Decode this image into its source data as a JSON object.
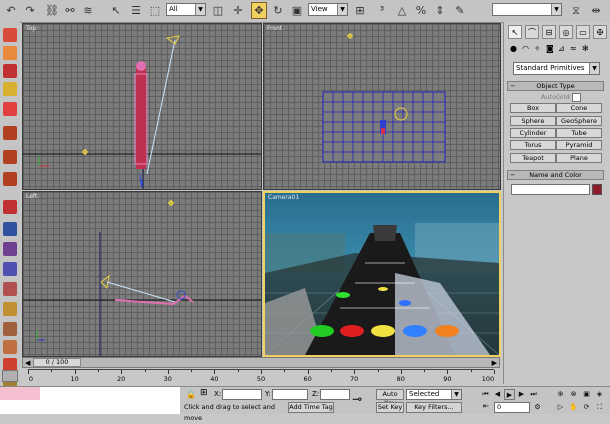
{
  "toolbar": {
    "selection_filter": "All",
    "reference_coord": "View"
  },
  "viewports": {
    "top": "Top",
    "front": "Front",
    "left": "Left",
    "camera": "Camera01"
  },
  "command_panel": {
    "category": "Standard Primitives",
    "object_type_title": "Object Type",
    "autogrid_label": "AutoGrid",
    "buttons": [
      "Box",
      "Cone",
      "Sphere",
      "GeoSphere",
      "Cylinder",
      "Tube",
      "Torus",
      "Pyramid",
      "Teapot",
      "Plane"
    ],
    "name_color_title": "Name and Color",
    "object_color": "#8b1a2a"
  },
  "timeline": {
    "frame_display": "0 / 100",
    "ticks": [
      "0",
      "10",
      "20",
      "30",
      "40",
      "50",
      "60",
      "70",
      "80",
      "90",
      "100"
    ]
  },
  "status": {
    "prompt": "Click and drag to select and move",
    "add_time_tag": "Add Time Tag",
    "x_label": "X:",
    "y_label": "Y:",
    "z_label": "Z:",
    "auto_key": "Auto Key",
    "set_key": "Set Key",
    "key_mode": "Selected",
    "key_filters": "Key Filters...",
    "current_frame": "0"
  },
  "colors": {
    "active_border": "#f0d060",
    "viewport_grid": "#7c7c7c"
  }
}
